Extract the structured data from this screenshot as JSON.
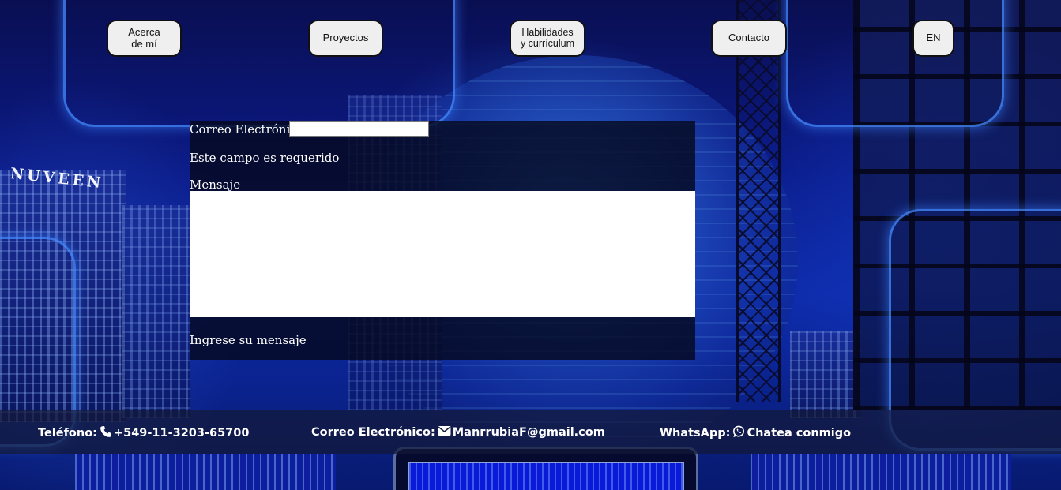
{
  "nav": {
    "about_label": "Acerca de mí",
    "projects_label": "Proyectos",
    "skills_label": "Habilidades y currículum",
    "contact_label": "Contacto",
    "language_label": "EN"
  },
  "background": {
    "sign_text": "NUVEEN"
  },
  "form": {
    "email_label": "Correo Electrónico",
    "email_value": "",
    "email_error": "Este campo es requerido",
    "message_label": "Mensaje",
    "message_value": "",
    "message_hint": "Ingrese su mensaje"
  },
  "footer": {
    "phone_label": "Teléfono:",
    "phone_icon": "phone-icon",
    "phone_value": "+549-11-3203-65700",
    "email_label": "Correo Electrónico:",
    "email_icon": "envelope-icon",
    "email_value": "ManrrubiaF@gmail.com",
    "whatsapp_label": "WhatsApp:",
    "whatsapp_icon": "whatsapp-icon",
    "whatsapp_value": "Chatea conmigo"
  },
  "colors": {
    "nav_button_bg": "#efefef",
    "form_panel_bg": "#05081e",
    "footer_text": "#ffffff",
    "background_blue": "#0b1a86"
  }
}
